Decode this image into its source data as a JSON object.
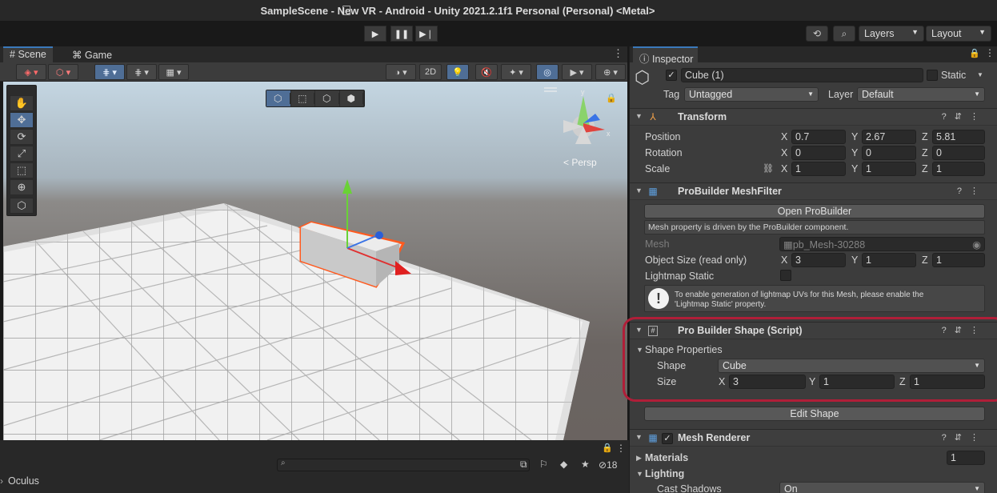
{
  "window": {
    "title": "SampleScene - New VR - Android - Unity 2021.2.1f1 Personal (Personal) <Metal>"
  },
  "toolbar": {
    "play_icon": "play-icon",
    "pause_icon": "pause-icon",
    "step_icon": "step-icon",
    "layers_label": "Layers",
    "layout_label": "Layout"
  },
  "scene": {
    "tabs": [
      {
        "label": "Scene",
        "icon": "hash-icon"
      },
      {
        "label": "Game",
        "icon": "gamepad-icon"
      }
    ],
    "mode_2d": "2D",
    "gizmo_label": "Persp",
    "gizmo_axes": {
      "y": "y",
      "x": "x"
    }
  },
  "project": {
    "breadcrumb": "Oculus",
    "hidden_count": "18"
  },
  "inspector": {
    "tab_label": "Inspector",
    "object_name": "Cube (1)",
    "static_label": "Static",
    "tag_label": "Tag",
    "tag_value": "Untagged",
    "layer_label": "Layer",
    "layer_value": "Default",
    "transform": {
      "name": "Transform",
      "position_label": "Position",
      "rotation_label": "Rotation",
      "scale_label": "Scale",
      "position": {
        "x": "0.7",
        "y": "2.67",
        "z": "5.81"
      },
      "rotation": {
        "x": "0",
        "y": "0",
        "z": "0"
      },
      "scale": {
        "x": "1",
        "y": "1",
        "z": "1"
      }
    },
    "meshfilter": {
      "name": "ProBuilder MeshFilter",
      "open_button": "Open ProBuilder",
      "note": "Mesh property is driven by the ProBuilder component.",
      "mesh_label": "Mesh",
      "mesh_value": "pb_Mesh-30288",
      "object_size_label": "Object Size (read only)",
      "object_size": {
        "x": "3",
        "y": "1",
        "z": "1"
      },
      "lightmap_label": "Lightmap Static",
      "warning_line1": "To enable generation of lightmap UVs for this Mesh, please enable the",
      "warning_line2": "'Lightmap Static' property."
    },
    "shape": {
      "name": "Pro Builder Shape (Script)",
      "props_label": "Shape Properties",
      "shape_label": "Shape",
      "shape_value": "Cube",
      "size_label": "Size",
      "size": {
        "x": "3",
        "y": "1",
        "z": "1"
      },
      "edit_button": "Edit Shape"
    },
    "renderer": {
      "name": "Mesh Renderer",
      "materials_label": "Materials",
      "materials_count": "1",
      "lighting_label": "Lighting",
      "cast_shadows_label": "Cast Shadows",
      "cast_shadows_value": "On"
    },
    "axis_labels": {
      "x": "X",
      "y": "Y",
      "z": "Z"
    }
  },
  "colors": {
    "highlight": "#b01e38",
    "selection_outline": "#ff5a1f",
    "accent": "#3a79bb"
  }
}
